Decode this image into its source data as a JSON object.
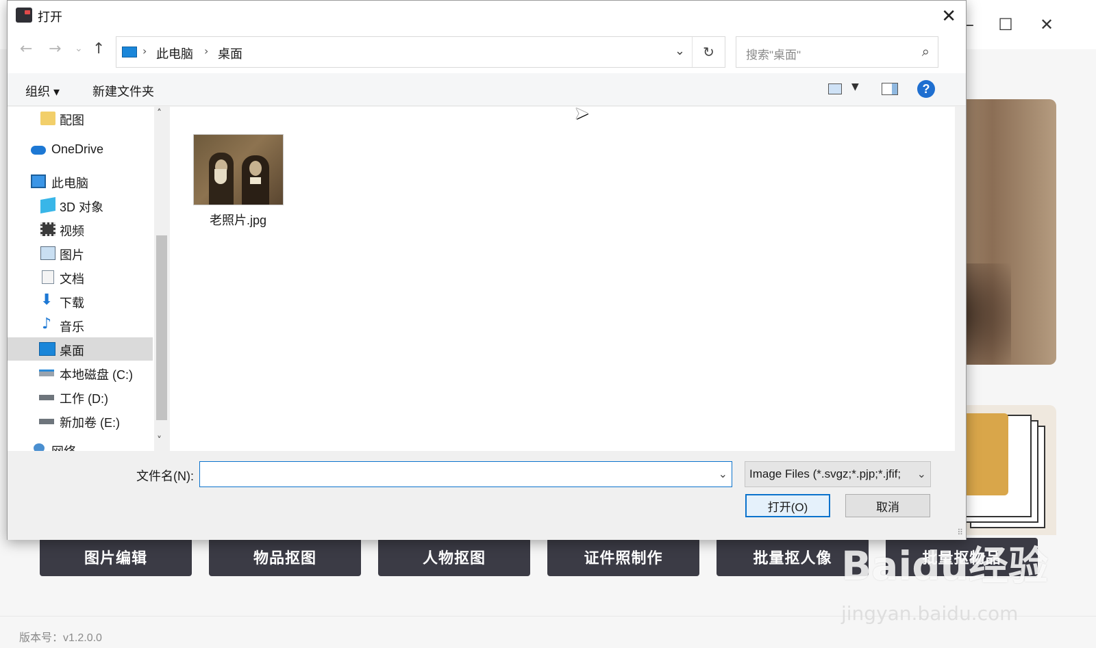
{
  "dialog": {
    "title": "打开",
    "close_glyph": "✕"
  },
  "nav": {
    "back_glyph": "←",
    "forward_glyph": "→",
    "recent_glyph": "⌄",
    "up_glyph": "↑",
    "breadcrumb": [
      "此电脑",
      "桌面"
    ],
    "separator": "›",
    "dropdown_glyph": "⌄",
    "refresh_glyph": "↻",
    "search_placeholder": "搜索\"桌面\"",
    "search_glyph": "⌕"
  },
  "toolbar": {
    "organize": "组织 ▾",
    "new_folder": "新建文件夹",
    "view_dd": "▼",
    "help": "?"
  },
  "sidebar": {
    "items": [
      {
        "label": "配图",
        "icon": "folder-icon"
      },
      {
        "label": "OneDrive",
        "icon": "onedrive-icon"
      },
      {
        "label": "此电脑",
        "icon": "computer-icon"
      },
      {
        "label": "3D 对象",
        "icon": "3d-objects-icon"
      },
      {
        "label": "视频",
        "icon": "video-icon"
      },
      {
        "label": "图片",
        "icon": "pictures-icon"
      },
      {
        "label": "文档",
        "icon": "documents-icon"
      },
      {
        "label": "下载",
        "icon": "download-icon"
      },
      {
        "label": "音乐",
        "icon": "music-icon"
      },
      {
        "label": "桌面",
        "icon": "desktop-icon",
        "selected": true
      },
      {
        "label": "本地磁盘 (C:)",
        "icon": "drive-c-icon"
      },
      {
        "label": "工作 (D:)",
        "icon": "drive-icon"
      },
      {
        "label": "新加卷 (E:)",
        "icon": "drive-icon"
      },
      {
        "label": "网络",
        "icon": "network-icon"
      }
    ],
    "scroll_up": "˄",
    "scroll_down": "˅"
  },
  "files": [
    {
      "name": "老照片.jpg",
      "icon": "old-photo-thumbnail"
    }
  ],
  "bottom": {
    "filename_label": "文件名(N):",
    "filename_value": "",
    "filetype_value": "Image Files (*.svgz;*.pjp;*.jfif;",
    "dropdown_glyph": "⌄",
    "open_button": "打开(O)",
    "cancel_button": "取消"
  },
  "app": {
    "window_controls": [
      "—",
      "☐",
      "✕"
    ],
    "buttons": [
      "图片编辑",
      "物品抠图",
      "人物抠图",
      "证件照制作",
      "批量抠人像",
      "批量抠物品"
    ],
    "version": "版本号：v1.2.0.0",
    "watermark": "Baidu经验",
    "watermark_sub": "jingyan.baidu.com"
  },
  "colors": {
    "accent": "#0a72cc",
    "app_button_bg": "#3b3b45",
    "selected_row": "#dadada"
  }
}
